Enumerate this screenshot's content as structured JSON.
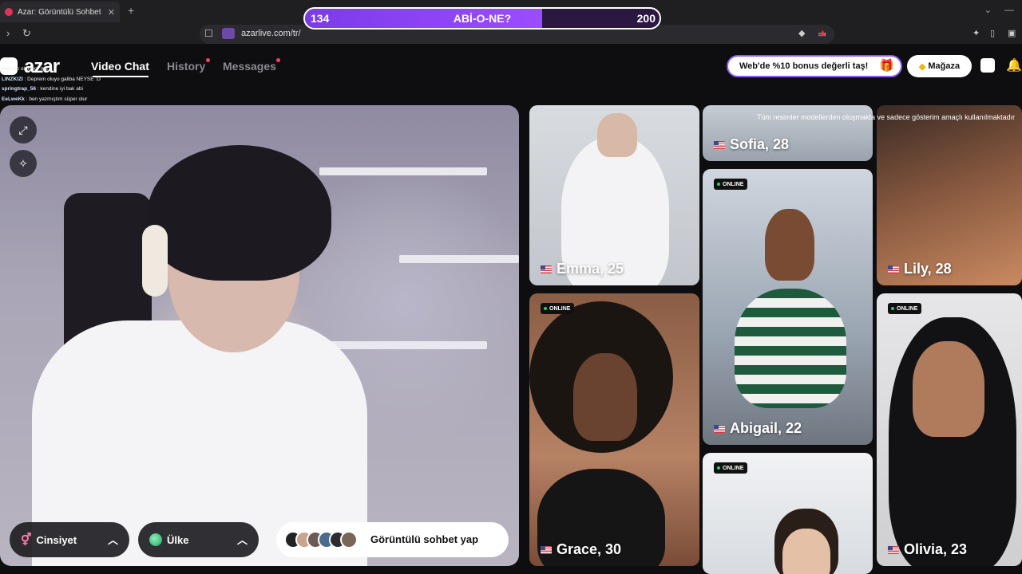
{
  "browser": {
    "tab_title": "Azar: Görüntülü Sohbet & Ye",
    "url": "azarlive.com/tr/"
  },
  "progress": {
    "current": "134",
    "max": "200",
    "fraction": 0.67,
    "label": "ABİ-O-NE?"
  },
  "site": {
    "logo": "azar",
    "nav": [
      {
        "label": "Video Chat",
        "active": true,
        "dot": false
      },
      {
        "label": "History",
        "active": false,
        "dot": true
      },
      {
        "label": "Messages",
        "active": false,
        "dot": true
      }
    ],
    "bonus_label": "Web'de %10 bonus değerli taş!",
    "store_label": "Mağaza"
  },
  "chat_log": [
    {
      "user": "",
      "text": "deprem olmuyor mu ?"
    },
    {
      "user": "LINZKIZI",
      "text": ": Deprem oluyo galiba NEYSE :D"
    },
    {
      "user": "springtrap_56",
      "text": ": kendine iyi bak abi"
    },
    {
      "user": "EeLweKk",
      "text": ": ben yazmıştım süper olur"
    }
  ],
  "controls": {
    "gender_label": "Cinsiyet",
    "country_label": "Ülke",
    "start_label": "Görüntülü sohbet yap"
  },
  "profiles": {
    "online_label": "ONLINE",
    "disclaimer": "Tüm resimler modellerden oluşmakta ve sadece gösterim amaçlı kullanılmaktadır",
    "cards": [
      {
        "name": "Emma, 25",
        "online": false
      },
      {
        "name": "Sofia, 28",
        "online": false
      },
      {
        "name": "Lily, 28",
        "online": false
      },
      {
        "name": "Grace, 30",
        "online": true
      },
      {
        "name": "Abigail, 22",
        "online": true
      },
      {
        "name": "Olivia, 23",
        "online": true
      },
      {
        "name": "",
        "online": true
      }
    ]
  },
  "colors": {
    "accent": "#8a5cf6",
    "online": "#22d36b",
    "notification": "#ff3b6b"
  }
}
